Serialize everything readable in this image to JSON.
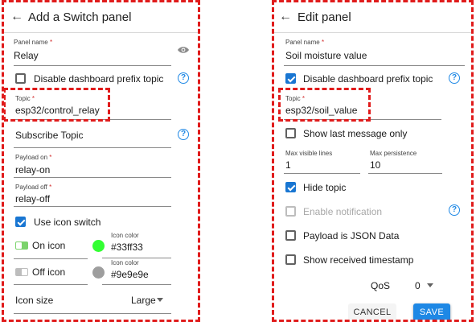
{
  "left": {
    "header_title": "Add a Switch panel",
    "panel_name": {
      "label": "Panel name",
      "required": "*",
      "value": "Relay"
    },
    "disable_prefix": {
      "label": "Disable dashboard prefix topic",
      "checked": false
    },
    "topic": {
      "label": "Topic",
      "required": "*",
      "value": "esp32/control_relay"
    },
    "subscribe_topic": {
      "label": "Subscribe Topic"
    },
    "payload_on": {
      "label": "Payload on",
      "required": "*",
      "value": "relay-on"
    },
    "payload_off": {
      "label": "Payload off",
      "required": "*",
      "value": "relay-off"
    },
    "use_icon_switch": {
      "label": "Use icon switch",
      "checked": true
    },
    "on_icon": {
      "label": "On icon",
      "color_label": "Icon color",
      "color_value": "#33ff33",
      "swatch": "#33ff33"
    },
    "off_icon": {
      "label": "Off icon",
      "color_label": "Icon color",
      "color_value": "#9e9e9e",
      "swatch": "#9e9e9e"
    },
    "icon_size": {
      "label": "Icon size",
      "value": "Large"
    }
  },
  "right": {
    "header_title": "Edit panel",
    "panel_name": {
      "label": "Panel name",
      "required": "*",
      "value": "Soil moisture value"
    },
    "disable_prefix": {
      "label": "Disable dashboard prefix topic",
      "checked": true
    },
    "topic": {
      "label": "Topic",
      "required": "*",
      "value": "esp32/soil_value"
    },
    "show_last": {
      "label": "Show last message only",
      "checked": false
    },
    "max_visible": {
      "label": "Max visible lines",
      "value": "1"
    },
    "max_persistence": {
      "label": "Max persistence",
      "value": "10"
    },
    "hide_topic": {
      "label": "Hide topic",
      "checked": true
    },
    "enable_notification": {
      "label": "Enable notification",
      "checked": false
    },
    "payload_json": {
      "label": "Payload is JSON Data",
      "checked": false
    },
    "show_timestamp": {
      "label": "Show received timestamp",
      "checked": false
    },
    "qos": {
      "label": "QoS",
      "value": "0"
    },
    "cancel_label": "CANCEL",
    "save_label": "SAVE"
  },
  "colors": {
    "accent": "#1e88e5",
    "highlight": "#e01b1b"
  }
}
